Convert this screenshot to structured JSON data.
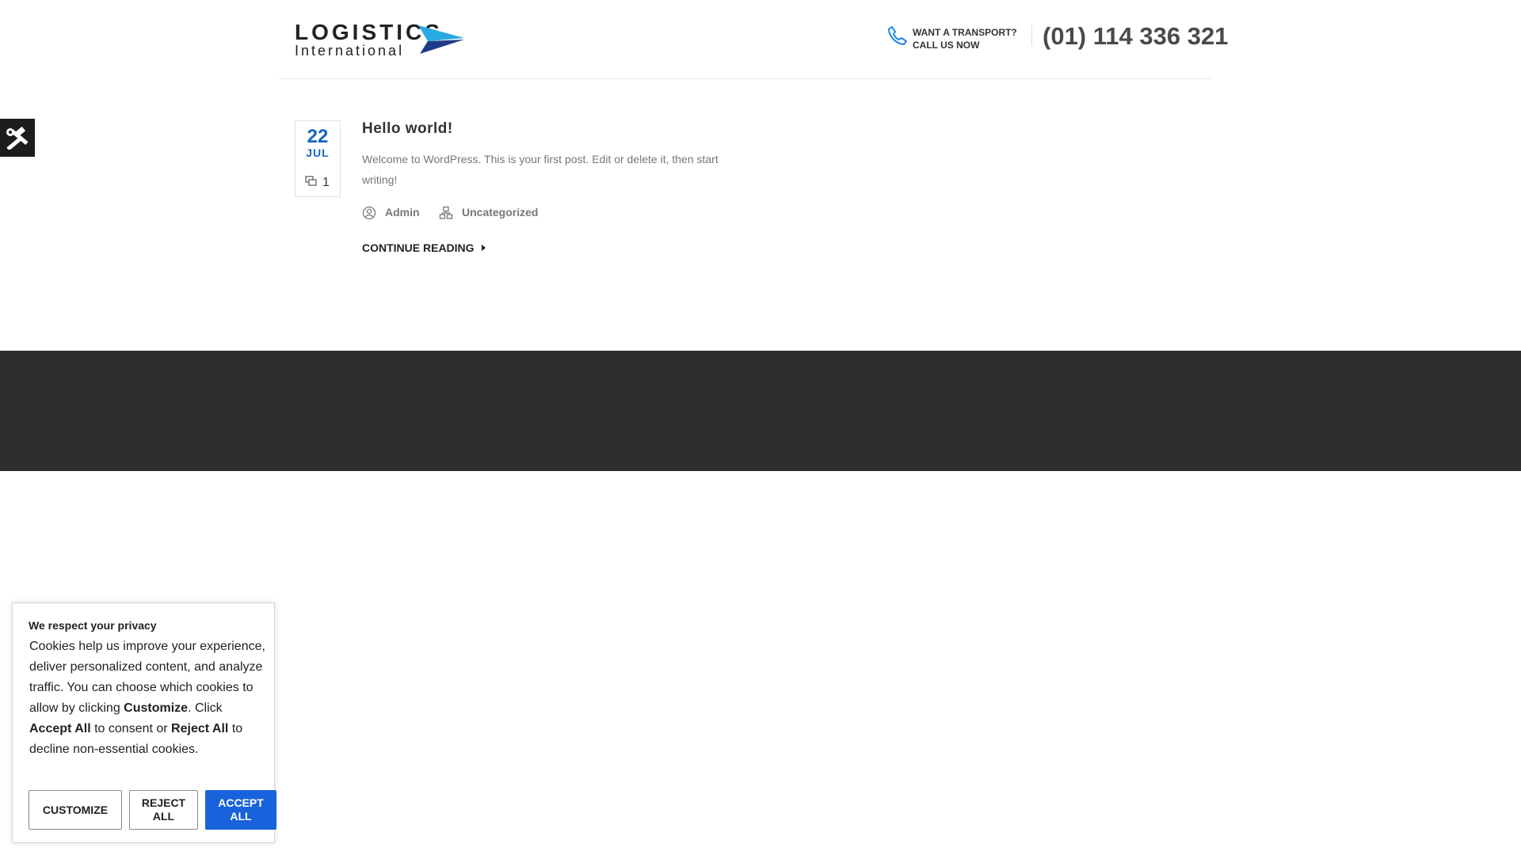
{
  "header": {
    "logo": {
      "line1": "LOGISTICS",
      "line2": "International"
    },
    "contact": {
      "label_line1": "WANT A TRANSPORT?",
      "label_line2": "CALL US NOW",
      "phone": "(01) 114 336 321"
    }
  },
  "side_tools": {
    "icon": "tools-icon"
  },
  "post": {
    "date": {
      "day": "22",
      "month": "JUL"
    },
    "comments_count": "1",
    "title": "Hello world!",
    "excerpt": "Welcome to WordPress. This is your first post. Edit or delete it, then start writing!",
    "author": "Admin",
    "category": "Uncategorized",
    "continue_label": "CONTINUE READING"
  },
  "colors": {
    "accent_blue": "#1565c0",
    "footer_bg": "#2d2d2d",
    "accept_button": "#1863dc"
  },
  "cookie_banner": {
    "title": "We respect your privacy",
    "text_1": "Cookies help us improve your experience, deliver personalized content, and analyze traffic. You can choose which cookies to allow by clicking ",
    "text_customize": "Customize",
    "text_2": ". Click ",
    "text_accept": "Accept All",
    "text_3": " to consent or ",
    "text_reject": "Reject All",
    "text_4": " to decline non-essential cookies.",
    "buttons": {
      "customize": "CUSTOMIZE",
      "reject_line1": "REJECT",
      "reject_line2": "ALL",
      "accept_line1": "ACCEPT",
      "accept_line2": "ALL"
    }
  }
}
